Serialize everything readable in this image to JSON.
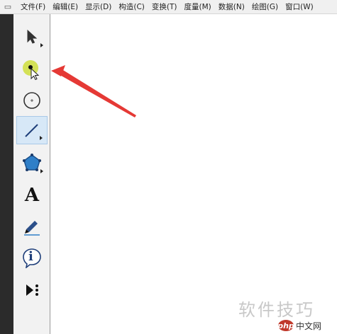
{
  "menubar": {
    "items": [
      "文件(F)",
      "编辑(E)",
      "显示(D)",
      "构造(C)",
      "变换(T)",
      "度量(M)",
      "数据(N)",
      "绘图(G)",
      "窗口(W)"
    ]
  },
  "toolbox": {
    "tools": [
      {
        "name": "arrow-select-tool",
        "icon": "arrow-cursor-icon"
      },
      {
        "name": "point-tool",
        "icon": "point-icon"
      },
      {
        "name": "compass-tool",
        "icon": "circle-icon"
      },
      {
        "name": "straightedge-tool",
        "icon": "line-segment-icon"
      },
      {
        "name": "polygon-tool",
        "icon": "polygon-icon"
      },
      {
        "name": "text-tool",
        "icon": "text-A-icon",
        "label": "A"
      },
      {
        "name": "marker-tool",
        "icon": "pen-icon"
      },
      {
        "name": "information-tool",
        "icon": "info-icon",
        "label": "i"
      },
      {
        "name": "custom-tool",
        "icon": "custom-tool-icon"
      }
    ]
  },
  "watermark": {
    "text": "软件技巧",
    "badge_logo": "php",
    "badge_text": "中文网"
  },
  "colors": {
    "selected_bg": "#d7e8f7",
    "point_highlight": "#d4e157",
    "annotation_arrow": "#e53935",
    "polygon_fill": "#2f7fc8"
  }
}
